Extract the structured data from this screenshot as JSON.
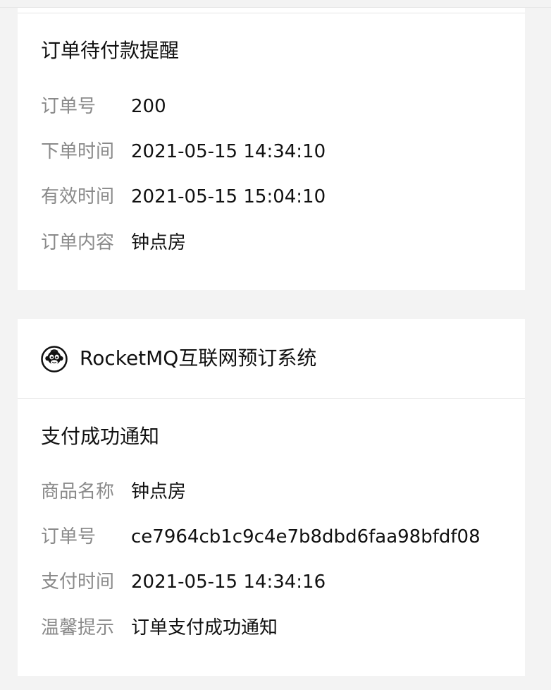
{
  "reminder_card": {
    "title": "订单待付款提醒",
    "rows": [
      {
        "label": "订单号",
        "value": "200"
      },
      {
        "label": "下单时间",
        "value": "2021-05-15 14:34:10"
      },
      {
        "label": "有效时间",
        "value": "2021-05-15 15:04:10"
      },
      {
        "label": "订单内容",
        "value": "钟点房"
      }
    ]
  },
  "payment_card": {
    "app_name": "RocketMQ互联网预订系统",
    "logo_icon": "monkey-logo-icon",
    "title": "支付成功通知",
    "rows": [
      {
        "label": "商品名称",
        "value": "钟点房"
      },
      {
        "label": "订单号",
        "value": "ce7964cb1c9c4e7b8dbd6faa98bfdf08"
      },
      {
        "label": "支付时间",
        "value": "2021-05-15 14:34:16"
      },
      {
        "label": "温馨提示",
        "value": "订单支付成功通知"
      }
    ]
  }
}
